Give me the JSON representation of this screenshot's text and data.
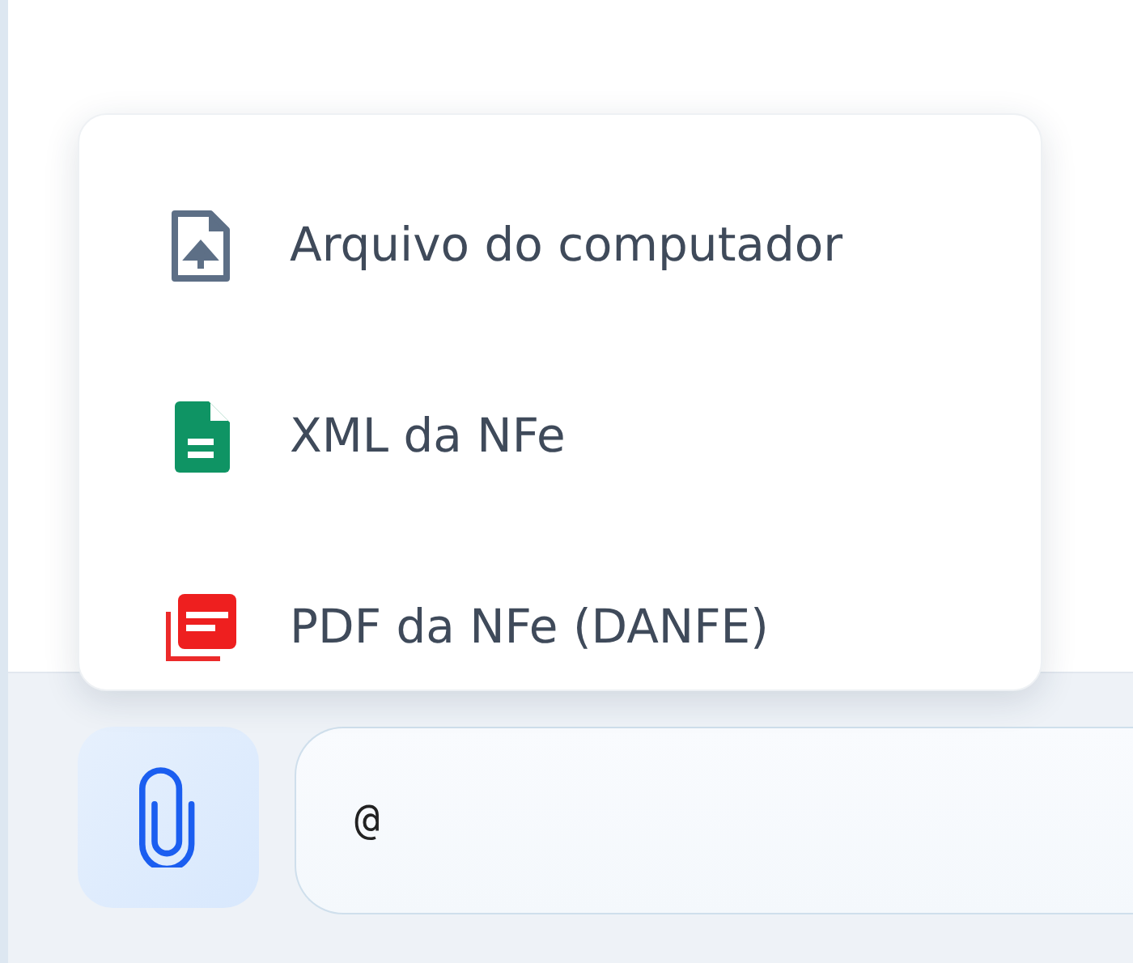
{
  "attach_menu": {
    "items": [
      {
        "kind": "upload",
        "label": "Arquivo do computador"
      },
      {
        "kind": "xml",
        "label": "XML da NFe"
      },
      {
        "kind": "pdf",
        "label": "PDF da NFe (DANFE)"
      }
    ]
  },
  "composer": {
    "message": {
      "value": "@"
    }
  }
}
